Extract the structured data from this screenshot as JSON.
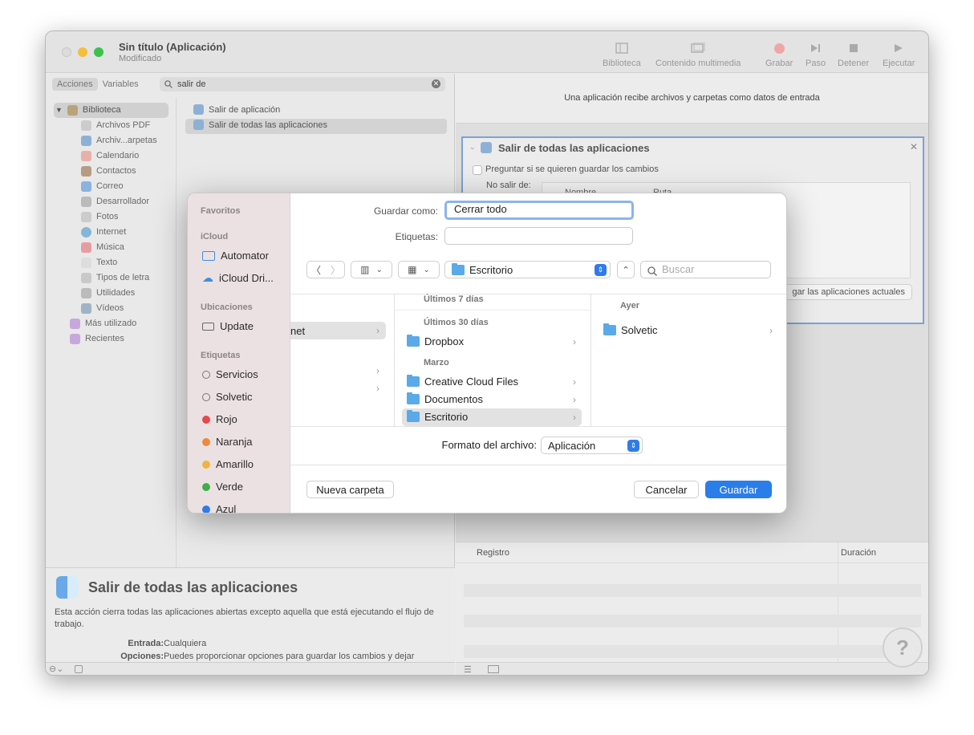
{
  "window": {
    "title": "Sin título (Aplicación)",
    "subtitle": "Modificado",
    "toolbar": [
      "Biblioteca",
      "Contenido multimedia",
      "Grabar",
      "Paso",
      "Detener",
      "Ejecutar"
    ]
  },
  "left": {
    "tabs": [
      "Acciones",
      "Variables"
    ],
    "search_value": "salir de",
    "library_root": "Biblioteca",
    "library_items": [
      "Archivos PDF",
      "Archiv...arpetas",
      "Calendario",
      "Contactos",
      "Correo",
      "Desarrollador",
      "Fotos",
      "Internet",
      "Música",
      "Texto",
      "Tipos de letra",
      "Utilidades",
      "Vídeos"
    ],
    "library_extra": [
      "Más utilizado",
      "Recientes"
    ],
    "actions": [
      "Salir de aplicación",
      "Salir de todas las aplicaciones"
    ],
    "description": {
      "title": "Salir de todas las aplicaciones",
      "text": "Esta acción cierra todas las aplicaciones abiertas excepto aquella que está ejecutando el flujo de trabajo.",
      "input_label": "Entrada:",
      "input_value": "Cualquiera",
      "options_label": "Opciones:",
      "options_value": "Puedes proporcionar opciones para guardar los cambios y dejar"
    }
  },
  "right": {
    "banner": "Una aplicación recibe archivos y carpetas como datos de entrada",
    "action_title": "Salir de todas las aplicaciones",
    "checkbox_label": "Preguntar si se quieren guardar los cambios",
    "nosalir_label": "No salir de:",
    "col_name": "Nombre",
    "col_path": "Ruta",
    "add_apps_partial": "gar las aplicaciones actuales",
    "log_col": "Registro",
    "duration_col": "Duración"
  },
  "dialog": {
    "sidebar": {
      "favorites_header": "Favoritos",
      "icloud_header": "iCloud",
      "icloud_items": [
        "Automator",
        "iCloud Dri..."
      ],
      "locations_header": "Ubicaciones",
      "locations_items": [
        "Update"
      ],
      "tags_header": "Etiquetas",
      "tags": [
        {
          "name": "Servicios",
          "color": ""
        },
        {
          "name": "Solvetic",
          "color": ""
        },
        {
          "name": "Rojo",
          "color": "#e5484d"
        },
        {
          "name": "Naranja",
          "color": "#ef8a3a"
        },
        {
          "name": "Amarillo",
          "color": "#f1b33c"
        },
        {
          "name": "Verde",
          "color": "#3fae49"
        },
        {
          "name": "Azul",
          "color": "#2f7bea"
        }
      ]
    },
    "save_as_label": "Guardar como:",
    "save_as_value": "Cerrar todo",
    "tags_label": "Etiquetas:",
    "location": "Escritorio",
    "search_placeholder": "Buscar",
    "col1_partial": "net",
    "col2": {
      "header_top": "Últimos 7 días",
      "header_30": "Últimos 30 días",
      "item_dropbox": "Dropbox",
      "header_marzo": "Marzo",
      "items_marzo": [
        "Creative Cloud Files",
        "Documentos",
        "Escritorio"
      ]
    },
    "col3": {
      "header": "Ayer",
      "item": "Solvetic"
    },
    "format_label": "Formato del archivo:",
    "format_value": "Aplicación",
    "new_folder": "Nueva carpeta",
    "cancel": "Cancelar",
    "save": "Guardar"
  }
}
